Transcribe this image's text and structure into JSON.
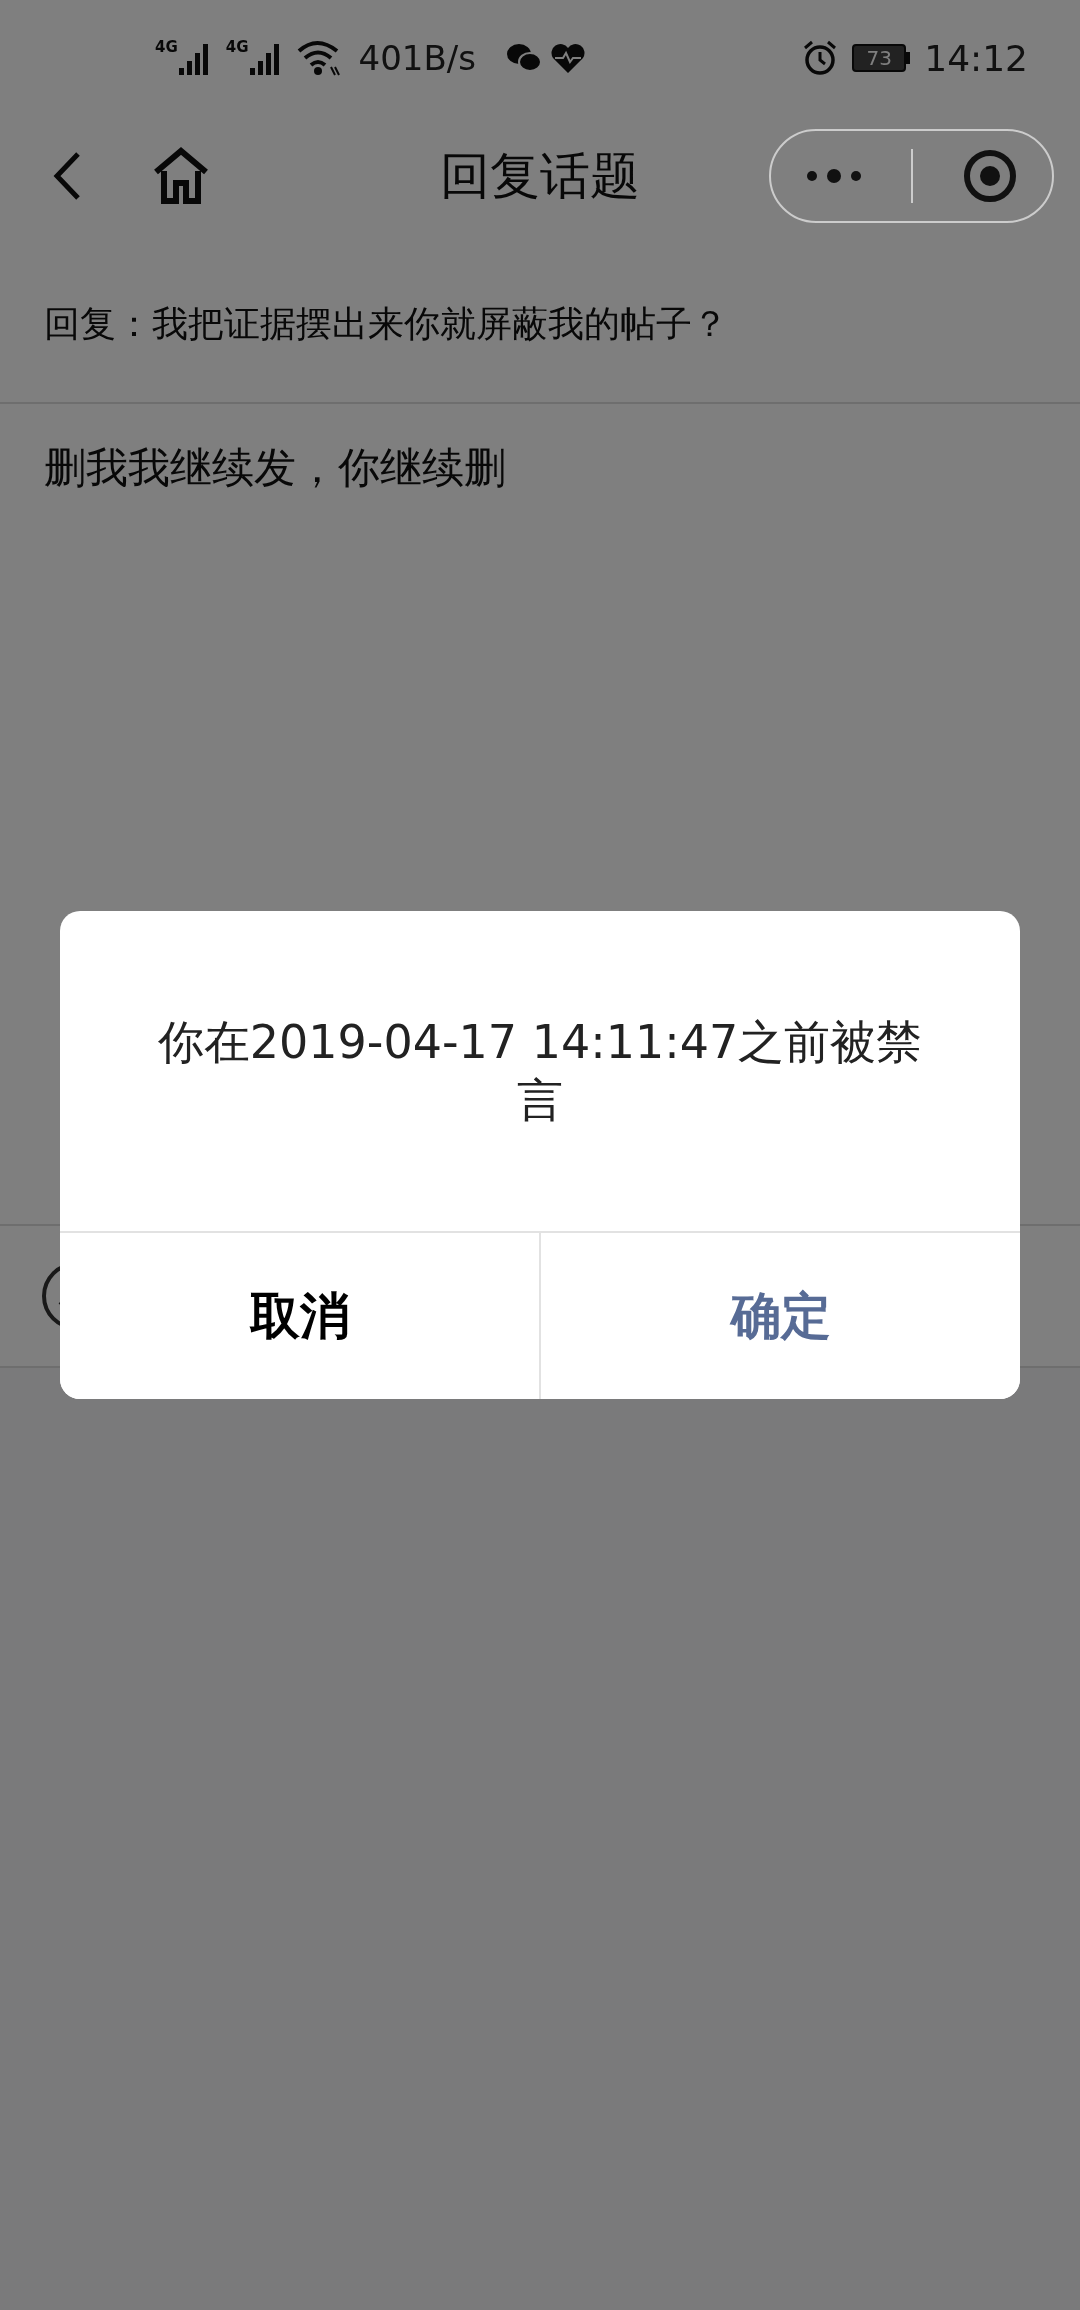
{
  "status_bar": {
    "network_labels": [
      "4G",
      "4G"
    ],
    "speed": "401B/s",
    "battery": "73",
    "time": "14:12"
  },
  "nav": {
    "title": "回复话题"
  },
  "reply_to": "回复：我把证据摆出来你就屏蔽我的帖子？",
  "content": "删我我继续发，你继续删",
  "dialog": {
    "message": "你在2019-04-17 14:11:47之前被禁言",
    "buttons": [
      {
        "label": "取消",
        "kind": "cancel"
      },
      {
        "label": "确定",
        "kind": "confirm"
      }
    ]
  }
}
